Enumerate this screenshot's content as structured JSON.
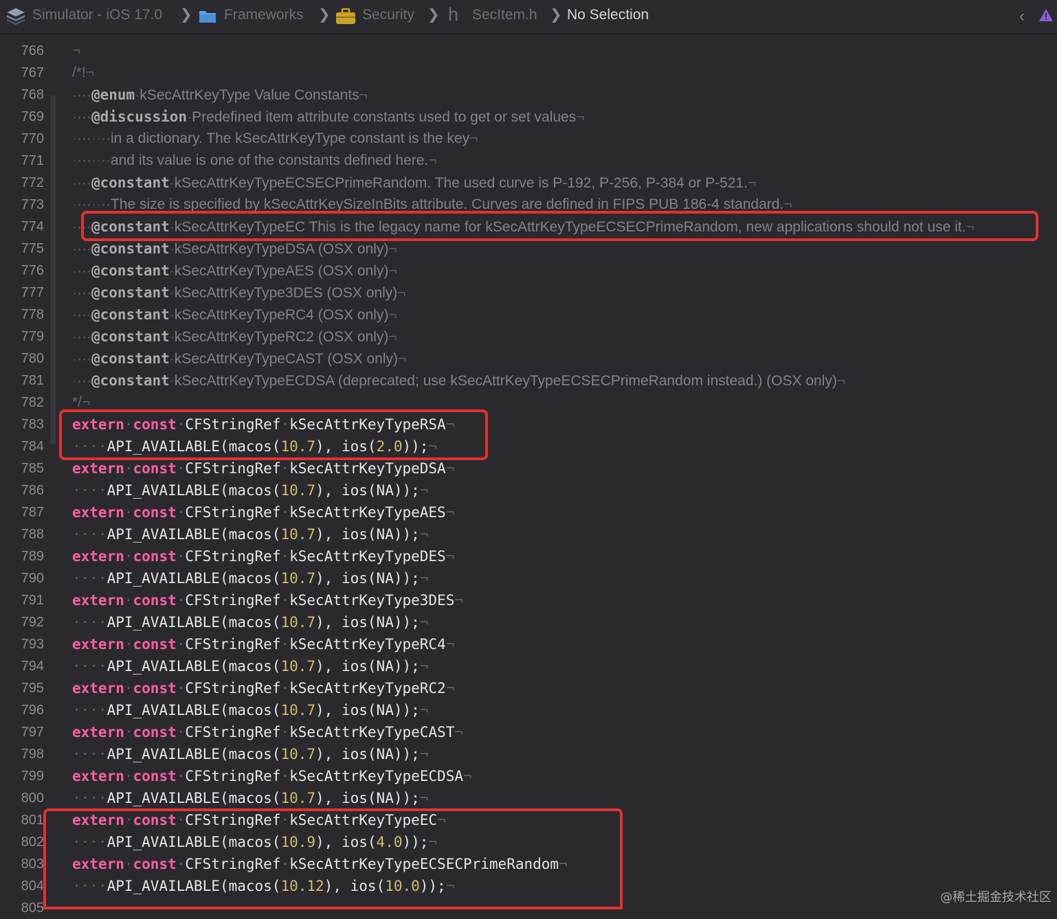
{
  "jumpbar": {
    "scheme": "Simulator - iOS 17.0",
    "crumbs": [
      "Frameworks",
      "Security",
      "SecItem.h"
    ],
    "file_glyph": "h",
    "selection": "No Selection",
    "sep": "❯",
    "back_glyph": "‹",
    "colors": {
      "warning": "#8e5cd9",
      "folder": "#5aa3e8",
      "toolbox": "#c9a227"
    }
  },
  "gutter": {
    "numbers": [
      "766",
      "767",
      "768",
      "769",
      "770",
      "771",
      "772",
      "773",
      "774",
      "775",
      "776",
      "777",
      "778",
      "779",
      "780",
      "781",
      "782",
      "783",
      "784",
      "785",
      "786",
      "787",
      "788",
      "789",
      "790",
      "791",
      "792",
      "793",
      "794",
      "795",
      "796",
      "797",
      "798",
      "799",
      "800",
      "801",
      "802",
      "803",
      "804",
      "805"
    ]
  },
  "inv": {
    "dot": "·",
    "eol": "¬"
  },
  "comment": {
    "open": "/*!",
    "close": "*/",
    "kw_enum": "@enum",
    "kw_discussion": "@discussion",
    "kw_constant": "@constant",
    "l768": "kSecAttrKeyType Value Constants",
    "l769": "Predefined item attribute constants used to get or set values",
    "l770": "in a dictionary. The kSecAttrKeyType constant is the key",
    "l771": "and its value is one of the constants defined here.",
    "l772": "kSecAttrKeyTypeECSECPrimeRandom. The used curve is P-192, P-256, P-384 or P-521.",
    "l773": "The size is specified by kSecAttrKeySizeInBits attribute. Curves are defined in FIPS PUB 186-4 standard.",
    "l774": "kSecAttrKeyTypeEC This is the legacy name for kSecAttrKeyTypeECSECPrimeRandom, new applications should not use it.",
    "l775": "kSecAttrKeyTypeDSA (OSX only)",
    "l776": "kSecAttrKeyTypeAES (OSX only)",
    "l777": "kSecAttrKeyType3DES (OSX only)",
    "l778": "kSecAttrKeyTypeRC4 (OSX only)",
    "l779": "kSecAttrKeyTypeRC2 (OSX only)",
    "l780": "kSecAttrKeyTypeCAST (OSX only)",
    "l781": "kSecAttrKeyTypeECDSA (deprecated; use kSecAttrKeyTypeECSECPrimeRandom instead.) (OSX only)"
  },
  "code": {
    "kw_extern": "extern",
    "kw_const": "const",
    "type": "CFStringRef",
    "macro": "API_AVAILABLE(macos(",
    "mid": "), ios(",
    "end": "));",
    "na": "NA",
    "decls": [
      {
        "name": "kSecAttrKeyTypeRSA",
        "macos": "10.7",
        "ios": "2.0"
      },
      {
        "name": "kSecAttrKeyTypeDSA",
        "macos": "10.7",
        "ios": "NA"
      },
      {
        "name": "kSecAttrKeyTypeAES",
        "macos": "10.7",
        "ios": "NA"
      },
      {
        "name": "kSecAttrKeyTypeDES",
        "macos": "10.7",
        "ios": "NA"
      },
      {
        "name": "kSecAttrKeyType3DES",
        "macos": "10.7",
        "ios": "NA"
      },
      {
        "name": "kSecAttrKeyTypeRC4",
        "macos": "10.7",
        "ios": "NA"
      },
      {
        "name": "kSecAttrKeyTypeRC2",
        "macos": "10.7",
        "ios": "NA"
      },
      {
        "name": "kSecAttrKeyTypeCAST",
        "macos": "10.7",
        "ios": "NA"
      },
      {
        "name": "kSecAttrKeyTypeECDSA",
        "macos": "10.7",
        "ios": "NA"
      },
      {
        "name": "kSecAttrKeyTypeEC",
        "macos": "10.9",
        "ios": "4.0"
      },
      {
        "name": "kSecAttrKeyTypeECSECPrimeRandom",
        "macos": "10.12",
        "ios": "10.0"
      }
    ]
  },
  "colors": {
    "highlight_box": "#e5322e",
    "keyword": "#fc5fa3",
    "number": "#d0bf69"
  },
  "watermark": "@稀土掘金技术社区"
}
